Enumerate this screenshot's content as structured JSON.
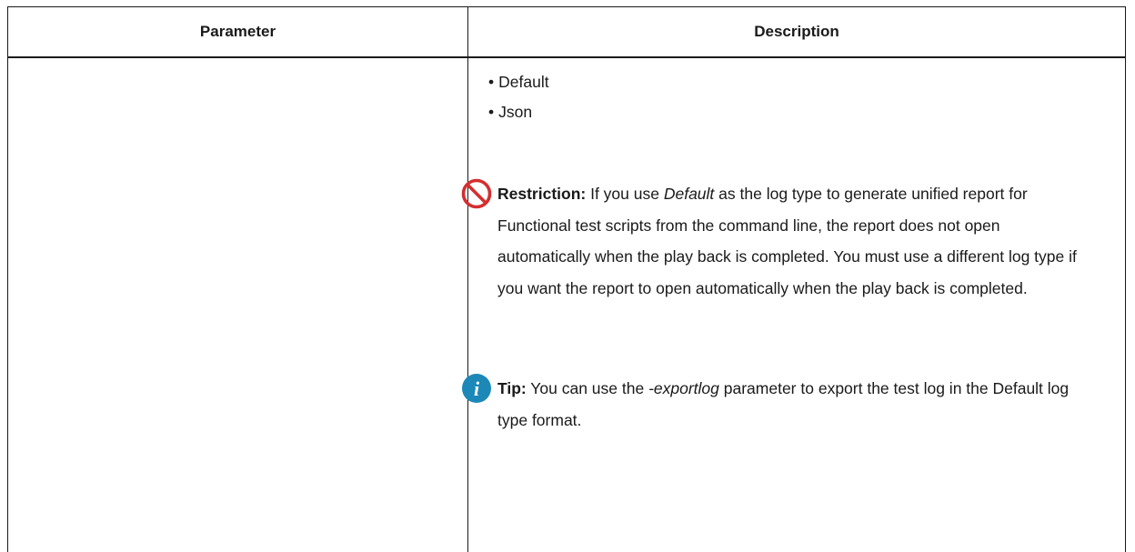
{
  "table": {
    "headers": {
      "parameter": "Parameter",
      "description": "Description"
    },
    "bullets": [
      "Default",
      "Json"
    ],
    "restriction": {
      "icon": "restriction-icon",
      "label": "Restriction:",
      "text_1": " If you use ",
      "emphasis": "Default",
      "text_2": " as the log type to generate unified report for Functional test scripts from the command line, the re­port does not open automatically when the play back is complet­ed. You must use a different log type if you want the report to open automatically when the play back is completed."
    },
    "tip": {
      "icon": "info-icon",
      "label": "Tip:",
      "text_1": " You can use the ",
      "emphasis": "-exportlog",
      "text_2": " parameter to export the test log in the Default log type format."
    }
  },
  "colors": {
    "restriction_icon": "#d32f2f",
    "info_icon": "#1c88b8",
    "border": "#1a1a1a",
    "text": "#1a1a1a"
  }
}
